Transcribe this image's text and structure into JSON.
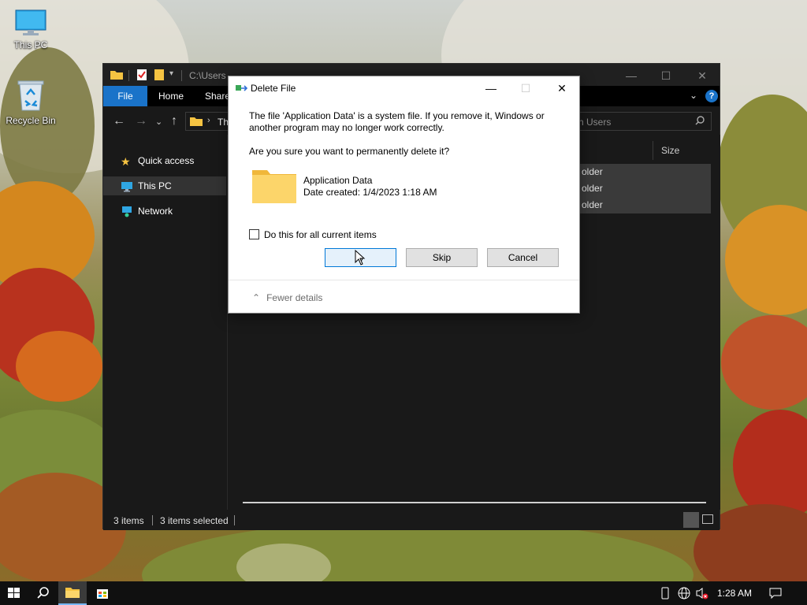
{
  "desktop": {
    "icons": [
      {
        "label": "This PC"
      },
      {
        "label": "Recycle Bin"
      }
    ]
  },
  "explorer": {
    "path_title": "C:\\Users",
    "ribbon_tabs": [
      "File",
      "Home",
      "Share"
    ],
    "breadcrumb": "Th",
    "search_placeholder": "h Users",
    "nav_items": [
      "Quick access",
      "This PC",
      "Network"
    ],
    "column_size": "Size",
    "rows": [
      "older",
      "older",
      "older"
    ],
    "status": {
      "items": "3 items",
      "selected": "3 items selected"
    }
  },
  "dialog": {
    "title": "Delete File",
    "message": "The file 'Application Data' is a system file. If you remove it, Windows or another program may no longer work correctly.",
    "question": "Are you sure you want to permanently delete it?",
    "file_name": "Application Data",
    "date_created": "Date created: 1/4/2023 1:18 AM",
    "checkbox_label": "Do this for all current items",
    "buttons": {
      "yes": "s",
      "skip": "Skip",
      "cancel": "Cancel"
    },
    "fewer_details": "Fewer details"
  },
  "taskbar": {
    "clock": "1:28 AM"
  },
  "colors": {
    "accent": "#1a73c9",
    "focus": "#0078d7"
  }
}
